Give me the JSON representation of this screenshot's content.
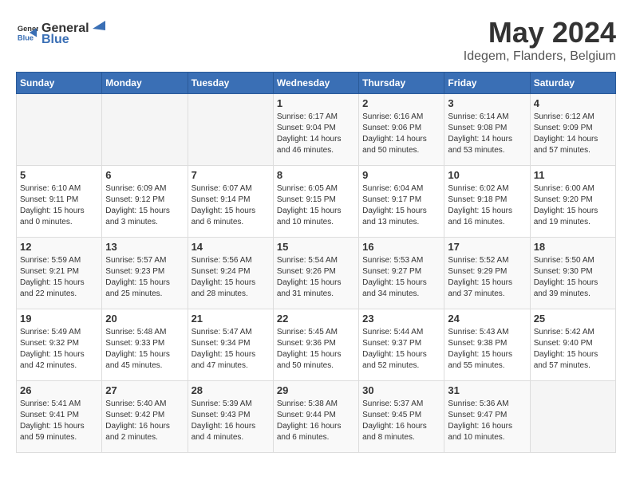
{
  "header": {
    "logo_general": "General",
    "logo_blue": "Blue",
    "month_year": "May 2024",
    "location": "Idegem, Flanders, Belgium"
  },
  "weekdays": [
    "Sunday",
    "Monday",
    "Tuesday",
    "Wednesday",
    "Thursday",
    "Friday",
    "Saturday"
  ],
  "weeks": [
    [
      {
        "day": "",
        "info": ""
      },
      {
        "day": "",
        "info": ""
      },
      {
        "day": "",
        "info": ""
      },
      {
        "day": "1",
        "info": "Sunrise: 6:17 AM\nSunset: 9:04 PM\nDaylight: 14 hours\nand 46 minutes."
      },
      {
        "day": "2",
        "info": "Sunrise: 6:16 AM\nSunset: 9:06 PM\nDaylight: 14 hours\nand 50 minutes."
      },
      {
        "day": "3",
        "info": "Sunrise: 6:14 AM\nSunset: 9:08 PM\nDaylight: 14 hours\nand 53 minutes."
      },
      {
        "day": "4",
        "info": "Sunrise: 6:12 AM\nSunset: 9:09 PM\nDaylight: 14 hours\nand 57 minutes."
      }
    ],
    [
      {
        "day": "5",
        "info": "Sunrise: 6:10 AM\nSunset: 9:11 PM\nDaylight: 15 hours\nand 0 minutes."
      },
      {
        "day": "6",
        "info": "Sunrise: 6:09 AM\nSunset: 9:12 PM\nDaylight: 15 hours\nand 3 minutes."
      },
      {
        "day": "7",
        "info": "Sunrise: 6:07 AM\nSunset: 9:14 PM\nDaylight: 15 hours\nand 6 minutes."
      },
      {
        "day": "8",
        "info": "Sunrise: 6:05 AM\nSunset: 9:15 PM\nDaylight: 15 hours\nand 10 minutes."
      },
      {
        "day": "9",
        "info": "Sunrise: 6:04 AM\nSunset: 9:17 PM\nDaylight: 15 hours\nand 13 minutes."
      },
      {
        "day": "10",
        "info": "Sunrise: 6:02 AM\nSunset: 9:18 PM\nDaylight: 15 hours\nand 16 minutes."
      },
      {
        "day": "11",
        "info": "Sunrise: 6:00 AM\nSunset: 9:20 PM\nDaylight: 15 hours\nand 19 minutes."
      }
    ],
    [
      {
        "day": "12",
        "info": "Sunrise: 5:59 AM\nSunset: 9:21 PM\nDaylight: 15 hours\nand 22 minutes."
      },
      {
        "day": "13",
        "info": "Sunrise: 5:57 AM\nSunset: 9:23 PM\nDaylight: 15 hours\nand 25 minutes."
      },
      {
        "day": "14",
        "info": "Sunrise: 5:56 AM\nSunset: 9:24 PM\nDaylight: 15 hours\nand 28 minutes."
      },
      {
        "day": "15",
        "info": "Sunrise: 5:54 AM\nSunset: 9:26 PM\nDaylight: 15 hours\nand 31 minutes."
      },
      {
        "day": "16",
        "info": "Sunrise: 5:53 AM\nSunset: 9:27 PM\nDaylight: 15 hours\nand 34 minutes."
      },
      {
        "day": "17",
        "info": "Sunrise: 5:52 AM\nSunset: 9:29 PM\nDaylight: 15 hours\nand 37 minutes."
      },
      {
        "day": "18",
        "info": "Sunrise: 5:50 AM\nSunset: 9:30 PM\nDaylight: 15 hours\nand 39 minutes."
      }
    ],
    [
      {
        "day": "19",
        "info": "Sunrise: 5:49 AM\nSunset: 9:32 PM\nDaylight: 15 hours\nand 42 minutes."
      },
      {
        "day": "20",
        "info": "Sunrise: 5:48 AM\nSunset: 9:33 PM\nDaylight: 15 hours\nand 45 minutes."
      },
      {
        "day": "21",
        "info": "Sunrise: 5:47 AM\nSunset: 9:34 PM\nDaylight: 15 hours\nand 47 minutes."
      },
      {
        "day": "22",
        "info": "Sunrise: 5:45 AM\nSunset: 9:36 PM\nDaylight: 15 hours\nand 50 minutes."
      },
      {
        "day": "23",
        "info": "Sunrise: 5:44 AM\nSunset: 9:37 PM\nDaylight: 15 hours\nand 52 minutes."
      },
      {
        "day": "24",
        "info": "Sunrise: 5:43 AM\nSunset: 9:38 PM\nDaylight: 15 hours\nand 55 minutes."
      },
      {
        "day": "25",
        "info": "Sunrise: 5:42 AM\nSunset: 9:40 PM\nDaylight: 15 hours\nand 57 minutes."
      }
    ],
    [
      {
        "day": "26",
        "info": "Sunrise: 5:41 AM\nSunset: 9:41 PM\nDaylight: 15 hours\nand 59 minutes."
      },
      {
        "day": "27",
        "info": "Sunrise: 5:40 AM\nSunset: 9:42 PM\nDaylight: 16 hours\nand 2 minutes."
      },
      {
        "day": "28",
        "info": "Sunrise: 5:39 AM\nSunset: 9:43 PM\nDaylight: 16 hours\nand 4 minutes."
      },
      {
        "day": "29",
        "info": "Sunrise: 5:38 AM\nSunset: 9:44 PM\nDaylight: 16 hours\nand 6 minutes."
      },
      {
        "day": "30",
        "info": "Sunrise: 5:37 AM\nSunset: 9:45 PM\nDaylight: 16 hours\nand 8 minutes."
      },
      {
        "day": "31",
        "info": "Sunrise: 5:36 AM\nSunset: 9:47 PM\nDaylight: 16 hours\nand 10 minutes."
      },
      {
        "day": "",
        "info": ""
      }
    ]
  ]
}
